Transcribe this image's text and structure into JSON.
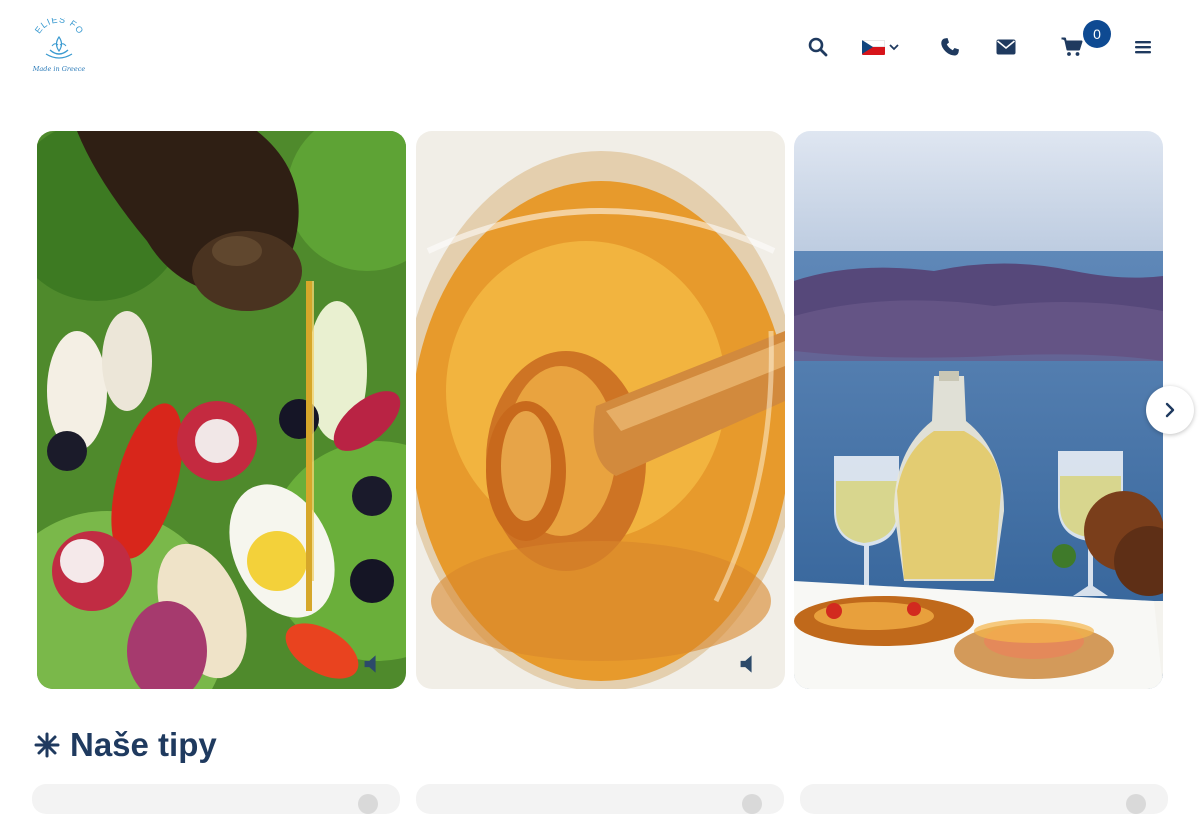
{
  "header": {
    "logo_text": "ELIES FOOD",
    "logo_tagline": "Made in Greece",
    "icons": [
      "search-icon",
      "czech-flag-icon",
      "chevron-down-icon",
      "phone-icon",
      "envelope-icon",
      "cart-icon",
      "menu-icon"
    ],
    "cart_count": "0",
    "language": "cs"
  },
  "carousel": {
    "slides": [
      {
        "name": "salad-with-olive-oil",
        "has_sound_toggle": true
      },
      {
        "name": "honey-jar-dipper",
        "has_sound_toggle": true
      },
      {
        "name": "santorini-wine-food",
        "has_sound_toggle": false
      }
    ],
    "next_icon": "chevron-right-icon"
  },
  "section": {
    "title": "Naše tipy",
    "title_icon": "asterisk-icon"
  },
  "colors": {
    "brand_navy": "#1f3a5f",
    "badge_blue": "#0e4a92",
    "logo_teal": "#3a9ad0"
  }
}
